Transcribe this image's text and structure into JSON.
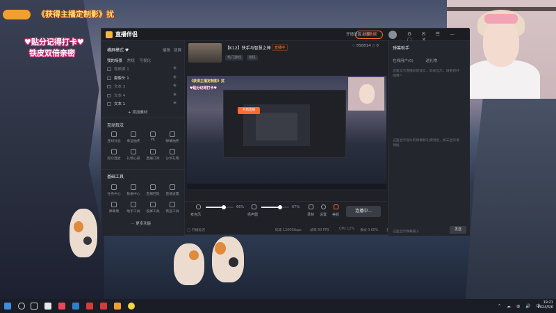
{
  "overlay": {
    "title": "《获得主播定制影》扰",
    "line1": "♥贴分记得打卡♥",
    "line2": "铁皮双倍亲密"
  },
  "app": {
    "name": "直播伴侣",
    "main_button": "主播数据",
    "header_icons": "⚙ ✉ ☰ — ▢ ✕",
    "sidebar": {
      "mode_title": "横屏模式 ♥",
      "mode_right": "编辑",
      "mode_right2": "竖屏",
      "tabs": [
        "我的场景",
        "常规",
        "可视化"
      ],
      "sources": [
        {
          "label": "视频源 1"
        },
        {
          "label": "摄像头 1"
        },
        {
          "label": "文本 3"
        },
        {
          "label": "文本 4"
        },
        {
          "label": "文本 1"
        }
      ],
      "add_source": "+ 添加素材",
      "interact_title": "互动玩法",
      "interact_items": [
        "连线对战",
        "幸运抽奖",
        "PK",
        "弹幕抽奖",
        "观众连麦",
        "礼物心愿",
        "直播订阅",
        "分享礼物"
      ],
      "tools_title": "基础工具",
      "tools_items": [
        "任务中心",
        "数据中心",
        "直播回放",
        "直播设置",
        "弹幕墙",
        "助手工具",
        "投屏工具",
        "商品工具"
      ],
      "more": "⋯ 更多功能"
    },
    "stream": {
      "title": "【K12】快手与智慧之神",
      "tag": "直播中",
      "categories": [
        "热门游戏",
        "单机"
      ],
      "stats": "♡ 858814  ◇ 0",
      "mini_buttons": "开播设置   分享"
    },
    "controls": {
      "mic_label": "麦克风",
      "mic_value": "66%",
      "speaker_label": "扬声器",
      "speaker_value": "67%",
      "icons": [
        "录制",
        "设置",
        "美颜"
      ],
      "live_button": "连播中..."
    },
    "statusbar": {
      "left": "◯ 开播延迟",
      "items": [
        "码率 12000kbps",
        "帧率 60 FPS",
        "CPU 12%",
        "丢帧 0.00%",
        "直播时长 00:00"
      ]
    },
    "chat": {
      "title": "弹幕助手",
      "tabs": [
        "在线用户(0)",
        "送礼物"
      ],
      "desc1": "这里显示直播间的观众，如未显示，请重新开播哦~",
      "desc2": "这里显示观众的弹幕和礼物消息，如未显示请稍候",
      "input_placeholder": "这里显示弹幕输入",
      "send": "发送"
    }
  },
  "preview": {
    "overlay1": "《获得主播定制影》扰",
    "overlay2": "♥贴分记得打卡♥",
    "inner_button": "开始直播"
  },
  "taskbar": {
    "tray": "^ ☁ ◍ 🔊 中",
    "time": "19:21",
    "date": "2024/5/6"
  }
}
